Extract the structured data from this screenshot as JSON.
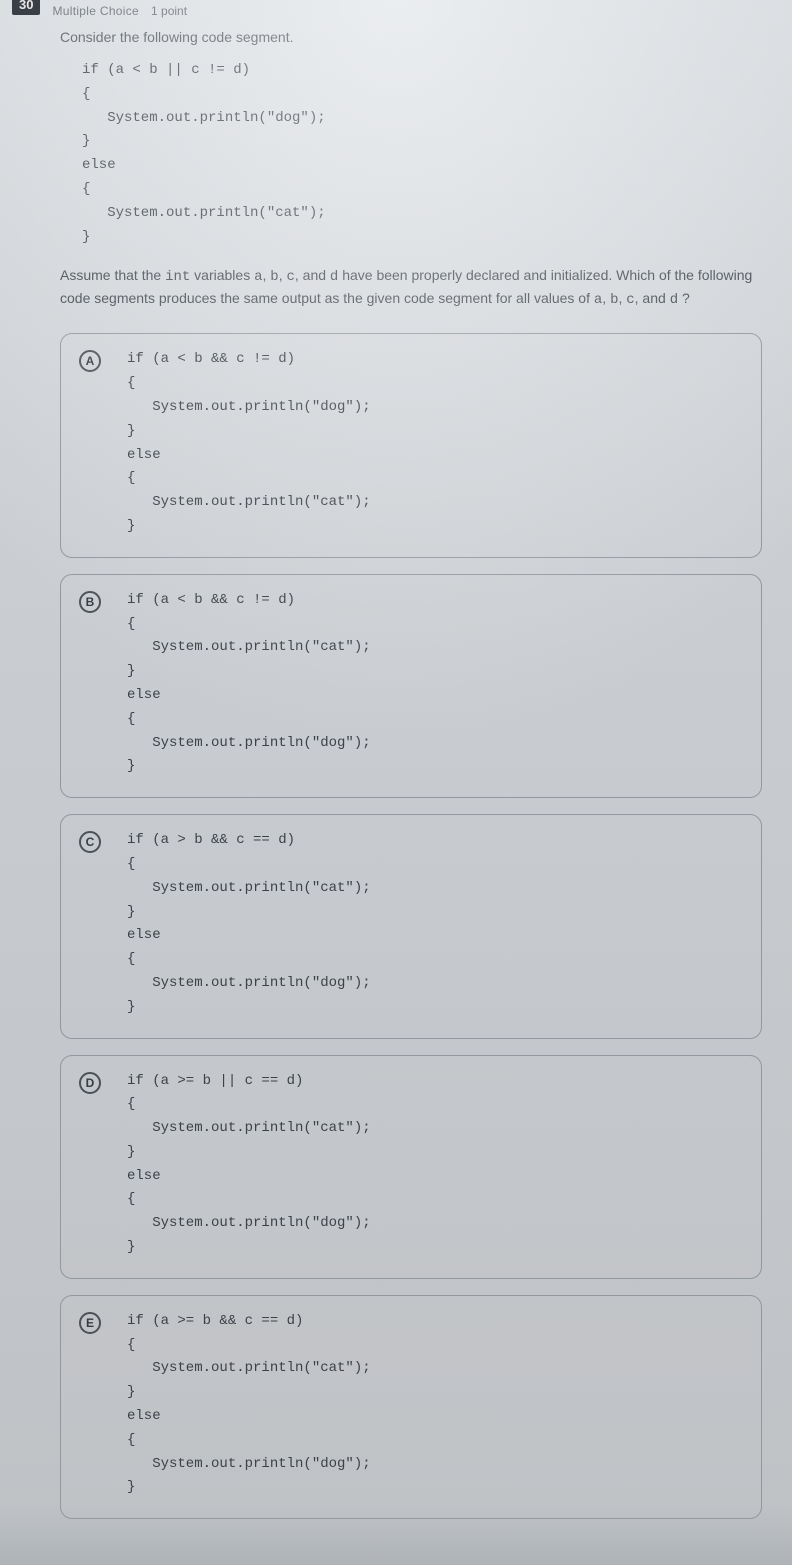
{
  "header": {
    "question_number": "30",
    "type_label": "Multiple Choice",
    "points_label": "1 point"
  },
  "prompt": {
    "intro": "Consider the following code segment.",
    "given_code": "if (a < b || c != d)\n{\n   System.out.println(\"dog\");\n}\nelse\n{\n   System.out.println(\"cat\");\n}",
    "question_pre": "Assume that the ",
    "question_mono1": "int",
    "question_mid1": " variables ",
    "question_mono2": "a",
    "question_sep1": ", ",
    "question_mono3": "b",
    "question_sep2": ", ",
    "question_mono4": "c",
    "question_sep3": ", and ",
    "question_mono5": "d",
    "question_mid2": " have been properly declared and initialized. Which of the following code segments produces the same output as the given code segment for all values of ",
    "question_mono6": "a",
    "question_sep4": ", ",
    "question_mono7": "b",
    "question_sep5": ", ",
    "question_mono8": "c",
    "question_sep6": ", and ",
    "question_mono9": "d",
    "question_end": " ?"
  },
  "options": [
    {
      "letter": "A",
      "code": "if (a < b && c != d)\n{\n   System.out.println(\"dog\");\n}\nelse\n{\n   System.out.println(\"cat\");\n}"
    },
    {
      "letter": "B",
      "code": "if (a < b && c != d)\n{\n   System.out.println(\"cat\");\n}\nelse\n{\n   System.out.println(\"dog\");\n}"
    },
    {
      "letter": "C",
      "code": "if (a > b && c == d)\n{\n   System.out.println(\"cat\");\n}\nelse\n{\n   System.out.println(\"dog\");\n}"
    },
    {
      "letter": "D",
      "code": "if (a >= b || c == d)\n{\n   System.out.println(\"cat\");\n}\nelse\n{\n   System.out.println(\"dog\");\n}"
    },
    {
      "letter": "E",
      "code": "if (a >= b && c == d)\n{\n   System.out.println(\"cat\");\n}\nelse\n{\n   System.out.println(\"dog\");\n}"
    }
  ]
}
